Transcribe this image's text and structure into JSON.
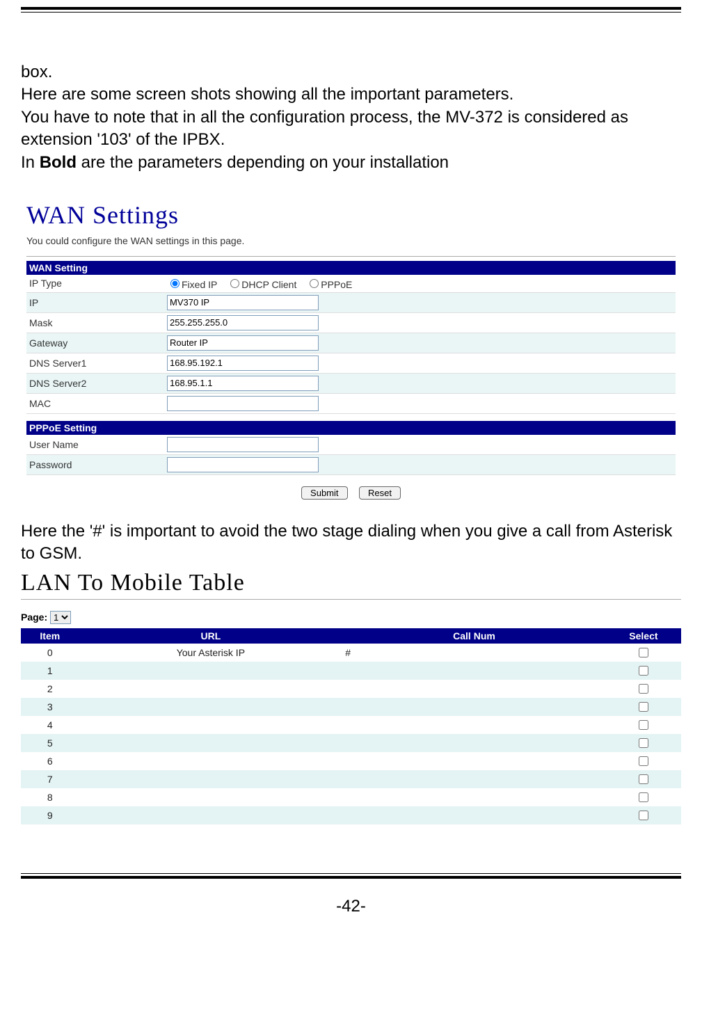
{
  "intro": {
    "line1": "box.",
    "line2": "Here are some screen shots showing all the important parameters.",
    "line3": "You have to note that in all the configuration process, the MV-372 is considered as extension '103' of the IPBX.",
    "line4_pre": "In ",
    "line4_bold": "Bold",
    "line4_post": " are the parameters depending on your installation"
  },
  "wan": {
    "title": "WAN Settings",
    "subtitle": "You could configure the WAN settings in this page.",
    "section1": "WAN Setting",
    "labels": {
      "ip_type": "IP Type",
      "ip": "IP",
      "mask": "Mask",
      "gateway": "Gateway",
      "dns1": "DNS Server1",
      "dns2": "DNS Server2",
      "mac": "MAC"
    },
    "ip_type_options": {
      "fixed": "Fixed IP",
      "dhcp": "DHCP Client",
      "pppoe": "PPPoE"
    },
    "values": {
      "ip": "MV370 IP",
      "mask": "255.255.255.0",
      "gateway": "Router IP",
      "dns1": "168.95.192.1",
      "dns2": "168.95.1.1",
      "mac": ""
    },
    "section2": "PPPoE Setting",
    "pppoe_labels": {
      "user": "User Name",
      "pass": "Password"
    },
    "pppoe_values": {
      "user": "",
      "pass": ""
    },
    "submit": "Submit",
    "reset": "Reset"
  },
  "mid_text": "Here the '#' is important to avoid the two stage dialing when you give a call from Asterisk to GSM.",
  "lan": {
    "title": "LAN To Mobile Table",
    "page_label": "Page:",
    "page_options": [
      "1"
    ],
    "page_selected": "1",
    "headers": {
      "item": "Item",
      "url": "URL",
      "call": "Call Num",
      "select": "Select"
    },
    "rows": [
      {
        "item": "0",
        "url": "Your Asterisk IP",
        "call": "#",
        "checked": false
      },
      {
        "item": "1",
        "url": "",
        "call": "",
        "checked": false
      },
      {
        "item": "2",
        "url": "",
        "call": "",
        "checked": false
      },
      {
        "item": "3",
        "url": "",
        "call": "",
        "checked": false
      },
      {
        "item": "4",
        "url": "",
        "call": "",
        "checked": false
      },
      {
        "item": "5",
        "url": "",
        "call": "",
        "checked": false
      },
      {
        "item": "6",
        "url": "",
        "call": "",
        "checked": false
      },
      {
        "item": "7",
        "url": "",
        "call": "",
        "checked": false
      },
      {
        "item": "8",
        "url": "",
        "call": "",
        "checked": false
      },
      {
        "item": "9",
        "url": "",
        "call": "",
        "checked": false
      }
    ]
  },
  "page_number": "-42-"
}
